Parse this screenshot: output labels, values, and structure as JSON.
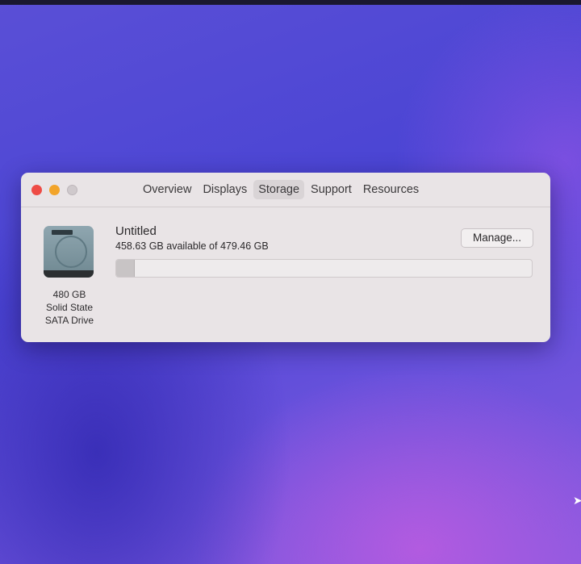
{
  "window": {
    "tabs": [
      {
        "label": "Overview",
        "active": false
      },
      {
        "label": "Displays",
        "active": false
      },
      {
        "label": "Storage",
        "active": true
      },
      {
        "label": "Support",
        "active": false
      },
      {
        "label": "Resources",
        "active": false
      }
    ],
    "drive": {
      "icon": "hard-drive-icon",
      "capacity": "480 GB",
      "type": "Solid State",
      "interface": "SATA Drive"
    },
    "volume": {
      "name": "Untitled",
      "availability": "458.63 GB available of 479.46 GB",
      "used_fraction": 0.043
    },
    "manage_label": "Manage...",
    "colors": {
      "close": "#ee4b45",
      "minimize": "#f2a42a"
    }
  }
}
